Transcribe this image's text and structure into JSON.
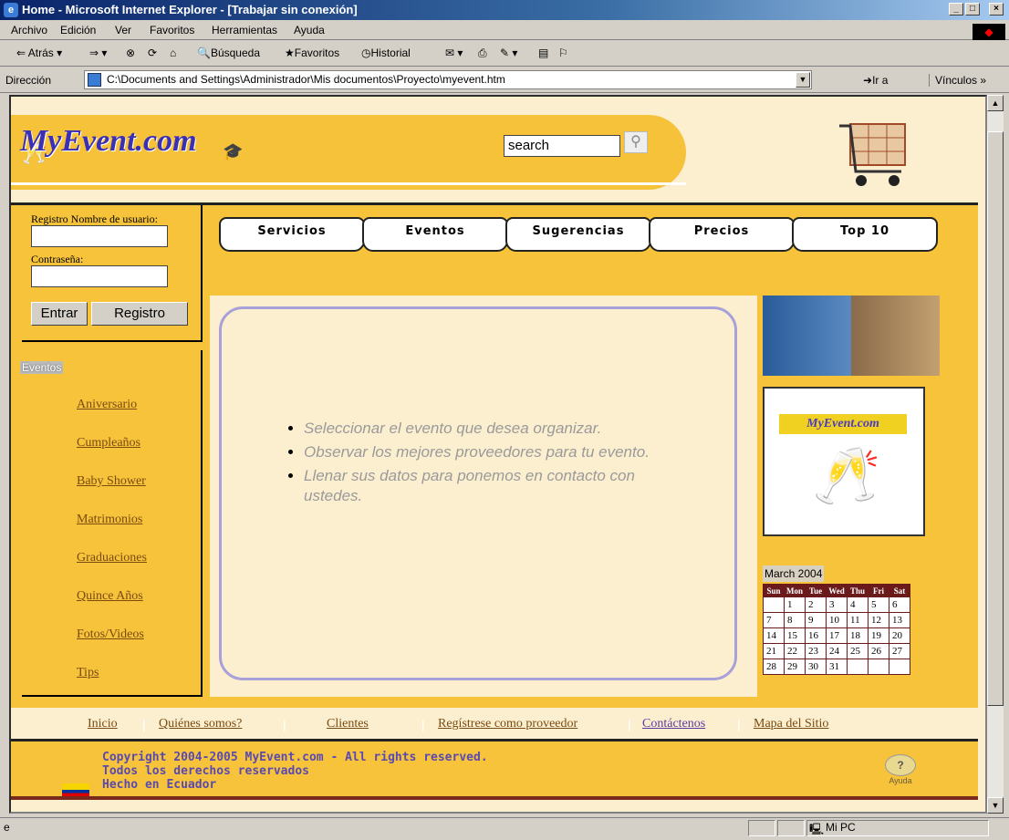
{
  "window": {
    "title": "Home - Microsoft Internet Explorer - [Trabajar sin conexión]"
  },
  "menu": [
    "Archivo",
    "Edición",
    "Ver",
    "Favoritos",
    "Herramientas",
    "Ayuda"
  ],
  "toolbar": {
    "back": "Atrás",
    "search": "Búsqueda",
    "favorites": "Favoritos",
    "history": "Historial"
  },
  "address": {
    "label": "Dirección",
    "value": "C:\\Documents and Settings\\Administrador\\Mis documentos\\Proyecto\\myevent.htm",
    "go": "Ir a",
    "links": "Vínculos"
  },
  "site": {
    "logo": "MyEvent.com",
    "search_placeholder": "search",
    "login": {
      "user_label": "Registro Nombre de usuario:",
      "pass_label": "Contraseña:",
      "enter": "Entrar",
      "register": "Registro"
    },
    "nav": [
      "Servicios",
      "Eventos",
      "Sugerencias",
      "Precios",
      "Top 10"
    ],
    "events_label": "Eventos",
    "events": [
      "Aniversario",
      "Cumpleaños",
      "Baby Shower",
      "Matrimonios",
      "Graduaciones",
      "Quince Años",
      "Fotos/Videos",
      "Tips"
    ],
    "bullets": [
      "Seleccionar el evento que desea organizar.",
      "Observar los mejores proveedores para tu evento.",
      "Llenar sus datos para ponemos en contacto con ustedes."
    ],
    "promo_logo": "MyEvent.com",
    "calendar": {
      "title": "March 2004",
      "days": [
        "Sun",
        "Mon",
        "Tue",
        "Wed",
        "Thu",
        "Fri",
        "Sat"
      ],
      "weeks": [
        [
          "",
          "1",
          "2",
          "3",
          "4",
          "5",
          "6"
        ],
        [
          "7",
          "8",
          "9",
          "10",
          "11",
          "12",
          "13"
        ],
        [
          "14",
          "15",
          "16",
          "17",
          "18",
          "19",
          "20"
        ],
        [
          "21",
          "22",
          "23",
          "24",
          "25",
          "26",
          "27"
        ],
        [
          "28",
          "29",
          "30",
          "31",
          "",
          "",
          ""
        ]
      ]
    },
    "footer_links": [
      "Inicio",
      "Quiénes somos?",
      "Clientes",
      "Regístrese como proveedor",
      "Contáctenos",
      "Mapa del Sitio"
    ],
    "copyright": [
      "Copyright 2004-2005 MyEvent.com - All rights reserved.",
      "Todos los derechos reservados",
      "Hecho en Ecuador"
    ],
    "help": "Ayuda"
  },
  "status": {
    "zone": "Mi PC"
  }
}
